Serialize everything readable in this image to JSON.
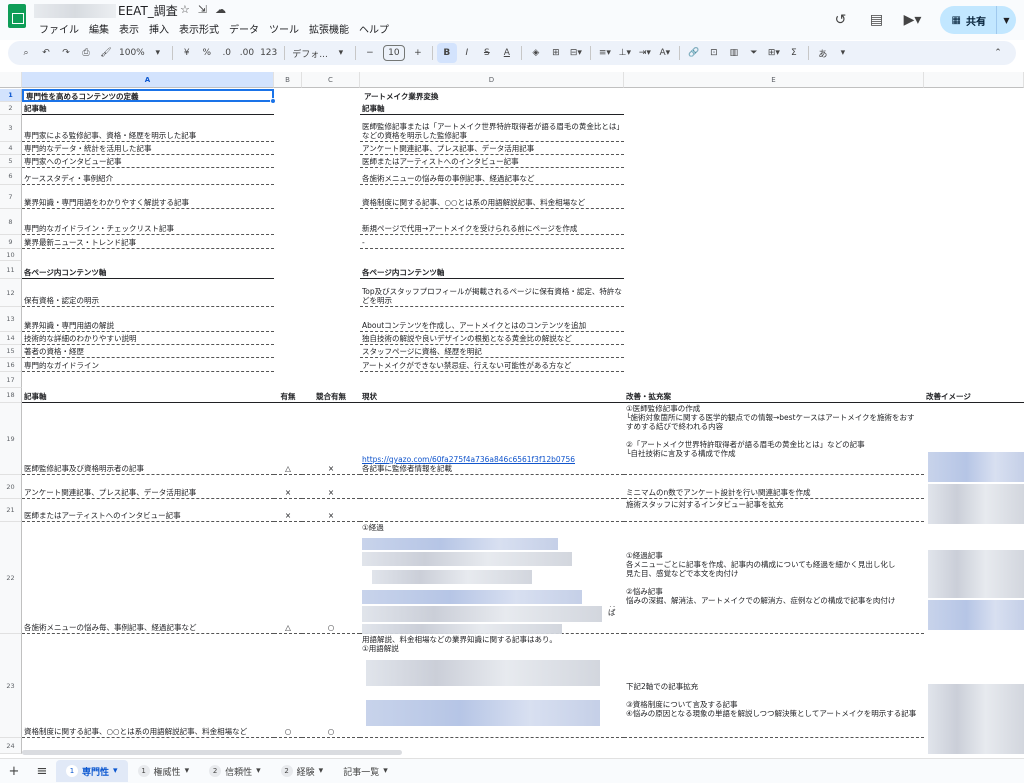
{
  "window": {
    "doc_title": "EEAT_調査",
    "menu": [
      "ファイル",
      "編集",
      "表示",
      "挿入",
      "表示形式",
      "データ",
      "ツール",
      "拡張機能",
      "ヘルプ"
    ],
    "share_label": "共有"
  },
  "toolbar": {
    "zoom": "100%",
    "currency": "¥",
    "percent": "%",
    "dec_minus": ".0",
    "dec_plus": ".00",
    "number_format": "123",
    "font": "デフォ...",
    "font_size": "10",
    "bold": "B",
    "italic": "I",
    "strike": "S",
    "textcolor": "A",
    "ime": "あ"
  },
  "columns": [
    {
      "letter": "A"
    },
    {
      "letter": "B"
    },
    {
      "letter": "C"
    },
    {
      "letter": "D"
    },
    {
      "letter": "E"
    }
  ],
  "rows": {
    "r1": {
      "a": "専門性を高めるコンテンツの定義",
      "d": "アートメイク業界変換"
    },
    "r2": {
      "a": "記事軸",
      "d": "記事軸"
    },
    "r3": {
      "a": "専門家による監修記事、資格・経歴を明示した記事",
      "d": "医師監修記事または「アートメイク世界特許取得者が語る眉毛の黄金比とは」などの資格を明示した監修記事"
    },
    "r4": {
      "a": "専門的なデータ・統計を活用した記事",
      "d": "アンケート関連記事、プレス記事、データ活用記事"
    },
    "r5": {
      "a": "専門家へのインタビュー記事",
      "d": "医師またはアーティストへのインタビュー記事"
    },
    "r6": {
      "a": "ケーススタディ・事例紹介",
      "d": "各施術メニューの悩み毎の事例記事、経過記事など"
    },
    "r7": {
      "a": "業界知識・専門用語をわかりやすく解説する記事",
      "d": "資格制度に関する記事、○○とは系の用語解説記事、料金相場など"
    },
    "r8": {
      "a": "専門的なガイドライン・チェックリスト記事",
      "d": "新規ページで代用→アートメイクを受けられる前にページを作成"
    },
    "r9": {
      "a": "業界最新ニュース・トレンド記事",
      "d": "-"
    },
    "r11": {
      "a": "各ページ内コンテンツ軸",
      "d": "各ページ内コンテンツ軸"
    },
    "r12": {
      "a": "保有資格・認定の明示",
      "d": "Top及びスタッフプロフィールが掲載されるページに保有資格・認定、特許などを明示"
    },
    "r13": {
      "a": "業界知識・専門用語の解説",
      "d": "Aboutコンテンツを作成し、アートメイクとはのコンテンツを追加"
    },
    "r14": {
      "a": "技術的な詳細のわかりやすい説明",
      "d": "独自技術の解説や良いデザインの根拠となる黄金比の解説など"
    },
    "r15": {
      "a": "著者の資格・経歴",
      "d": "スタッフページに資格、経歴を明記"
    },
    "r16": {
      "a": "専門的なガイドライン",
      "d": "アートメイクができない禁忌症、行えない可能性がある方など"
    },
    "r18": {
      "a": "記事軸",
      "b": "有無",
      "c": "競合有無",
      "d": "現状",
      "e": "改善・拡充案",
      "f": "改善イメージ"
    },
    "r19": {
      "a": "医師監修記事及び資格明示者の記事",
      "b": "△",
      "c": "×",
      "d_link": "https://gyazo.com/60fa275f4a736a846c6561f3f12b0756",
      "d": "各記事に監修者情報を記載",
      "e": "①医師監修記事の作成\n└施術対象箇所に関する医学的観点での情報→bestケースはアートメイクを施術をおすすめする結びで終われる内容\n\n②「アートメイク世界特許取得者が語る眉毛の黄金比とは」などの記事\n└自社技術に言及する構成で作成"
    },
    "r20": {
      "a": "アンケート関連記事、プレス記事、データ活用記事",
      "b": "×",
      "c": "×",
      "e": "ミニマムのn数でアンケート設計を行い関連記事を作成"
    },
    "r21": {
      "a": "医師またはアーティストへのインタビュー記事",
      "b": "×",
      "c": "×",
      "e": "施術スタッフに対するインタビュー記事を拡充"
    },
    "r22": {
      "a": "各施術メニューの悩み毎、事例記事、経過記事など",
      "b": "△",
      "c": "○",
      "d": "①経過",
      "d_tail": "れば",
      "e": "①経過記事\n各メニューごとに記事を作成、記事内の構成についても経過を細かく見出し化し\n見た目、感覚などで本文を肉付け\n\n②悩み記事\n悩みの深掘、解消法、アートメイクでの解消方、症例などの構成で記事を肉付け"
    },
    "r23": {
      "a": "資格制度に関する記事、○○とは系の用語解説記事、料金相場など",
      "b": "○",
      "c": "○",
      "d": "用語解説、料金相場などの業界知識に関する記事はあり。\n①用語解説",
      "e": "下記2軸での記事拡充\n\n③資格制度について言及する記事\n④悩みの原因となる現象の単語を解説しつつ解決策としてアートメイクを明示する記事"
    }
  },
  "row_numbers": [
    "1",
    "2",
    "3",
    "4",
    "5",
    "6",
    "7",
    "8",
    "9",
    "10",
    "11",
    "12",
    "13",
    "14",
    "15",
    "16",
    "17",
    "18",
    "19",
    "20",
    "21",
    "22",
    "23",
    "24"
  ],
  "tabs": [
    {
      "num": "1",
      "label": "専門性",
      "active": true
    },
    {
      "num": "1",
      "label": "権威性"
    },
    {
      "num": "2",
      "label": "信頼性"
    },
    {
      "num": "2",
      "label": "経験"
    },
    {
      "label": "記事一覧"
    }
  ]
}
